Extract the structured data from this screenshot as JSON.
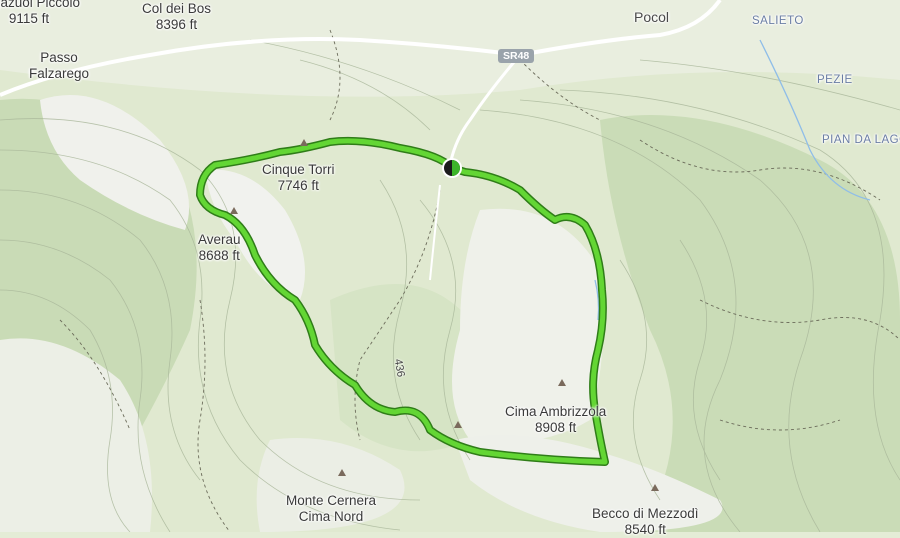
{
  "map": {
    "colors": {
      "terrain_base": "#e4ecd6",
      "forest": "#c6d9b4",
      "rock": "#f2f2ef",
      "route": "#5cd02f",
      "route_outline": "#2f7d18",
      "water": "#9dc4e6",
      "road": "#ffffff"
    },
    "labels": {
      "lagazuoi_name": "Lagazuoi Piccolo",
      "lagazuoi_elev": "9115 ft",
      "col_dei_bos_name": "Col dei Bos",
      "col_dei_bos_elev": "8396 ft",
      "pocol": "Pocol",
      "salieto": "SALIETO",
      "pezie": "PEZIE",
      "pian_da_lago": "PIAN DA LAGO",
      "passo_line1": "Passo",
      "passo_line2": "Falzarego",
      "cinque_torri_name": "Cinque Torri",
      "cinque_torri_elev": "7746 ft",
      "averau_name": "Averau",
      "averau_elev": "8688 ft",
      "cima_ambrizzola_name": "Cima Ambrizzola",
      "cima_ambrizzola_elev": "8908 ft",
      "monte_cernera_line1": "Monte Cernera",
      "monte_cernera_line2": "Cima Nord",
      "becco_name": "Becco di Mezzodì",
      "becco_elev": "8540 ft",
      "road_shield": "SR48",
      "trail_number": "436"
    },
    "icons": [
      "peak-icon",
      "start-end-icon"
    ]
  }
}
